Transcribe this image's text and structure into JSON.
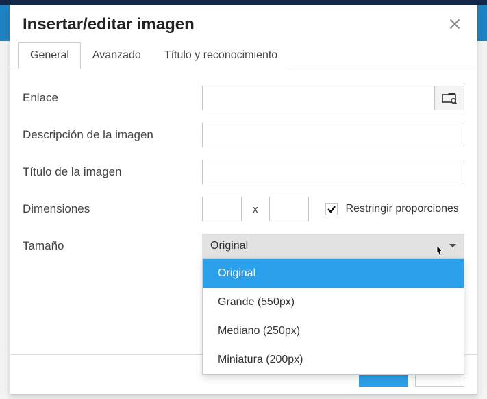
{
  "dialog": {
    "title": "Insertar/editar imagen"
  },
  "tabs": {
    "general": "General",
    "advanced": "Avanzado",
    "titleAck": "Título y reconocimiento"
  },
  "labels": {
    "link": "Enlace",
    "imageDesc": "Descripción de la imagen",
    "imageTitle": "Título de la imagen",
    "dimensions": "Dimensiones",
    "dimSep": "x",
    "constrain": "Restringir proporciones",
    "size": "Tamaño"
  },
  "values": {
    "link": "",
    "imageDesc": "",
    "imageTitle": "",
    "width": "",
    "height": "",
    "constrain": true,
    "sizeSelected": "Original"
  },
  "sizeOptions": [
    "Original",
    "Grande (550px)",
    "Mediano (250px)",
    "Miniatura (200px)"
  ]
}
